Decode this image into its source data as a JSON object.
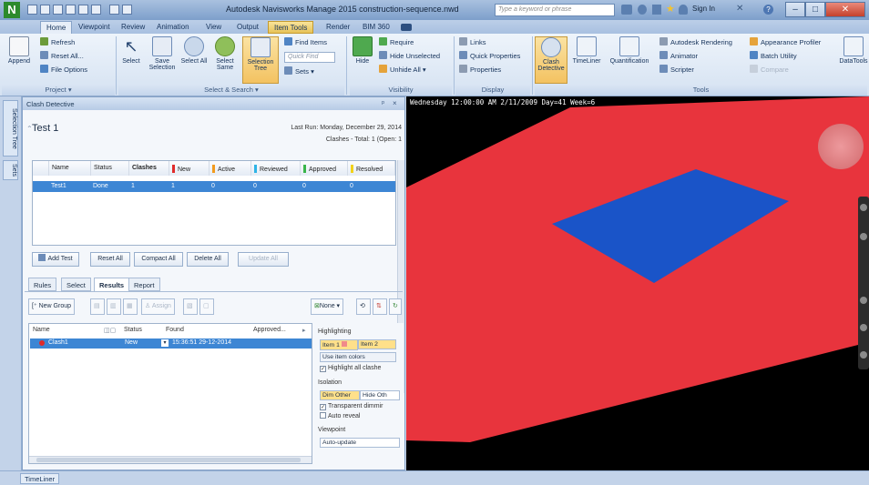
{
  "window": {
    "app_logo": "N",
    "title": "Autodesk Navisworks Manage 2015   construction-sequence.nwd",
    "search_placeholder": "Type a keyword or phrase",
    "sign_in": "Sign In",
    "colors": {
      "accent": "#3d86d4",
      "contextual_tab": "#e7c35a",
      "viewport_ground": "#e8343d",
      "viewport_plate": "#1a54c8"
    }
  },
  "tabs": [
    {
      "label": "Home"
    },
    {
      "label": "Viewpoint"
    },
    {
      "label": "Review"
    },
    {
      "label": "Animation"
    },
    {
      "label": "View"
    },
    {
      "label": "Output"
    },
    {
      "label": "Item Tools"
    },
    {
      "label": "Render"
    },
    {
      "label": "BIM 360"
    }
  ],
  "ribbon": {
    "project": {
      "append": "Append",
      "refresh": "Refresh",
      "reset_all": "Reset All...",
      "file_options": "File Options",
      "group_label": "Project ▾"
    },
    "select_search": {
      "select": "Select",
      "save_selection": "Save Selection",
      "select_all": "Select All",
      "select_same": "Select Same",
      "selection_tree": "Selection Tree",
      "find_items": "Find Items",
      "quick_find_placeholder": "Quick Find",
      "sets": "Sets",
      "group_label": "Select & Search ▾"
    },
    "visibility": {
      "hide": "Hide",
      "require": "Require",
      "hide_unselected": "Hide Unselected",
      "unhide_all": "Unhide All ▾",
      "group_label": "Visibility"
    },
    "display": {
      "links": "Links",
      "quick_properties": "Quick Properties",
      "properties": "Properties",
      "group_label": "Display"
    },
    "tools": {
      "clash_detective": "Clash Detective",
      "timeliner": "TimeLiner",
      "quantification": "Quantification",
      "autodesk_rendering": "Autodesk Rendering",
      "animator": "Animator",
      "scripter": "Scripter",
      "appearance_profiler": "Appearance Profiler",
      "batch_utility": "Batch Utility",
      "compare": "Compare",
      "datatools": "DataTools",
      "group_label": "Tools"
    }
  },
  "dock": {
    "selection_tree": "Selection Tree",
    "sets": "Sets"
  },
  "clash_panel": {
    "title": "Clash Detective",
    "pin": "×",
    "test_name": "Test 1",
    "last_run": "Last Run:  Monday, December 29, 2014",
    "summary": "Clashes - Total: 1  (Open: 1",
    "grid_headers": {
      "name": "Name",
      "status": "Status",
      "clashes": "Clashes",
      "new": "New",
      "active": "Active",
      "reviewed": "Reviewed",
      "approved": "Approved",
      "resolved": "Resolved"
    },
    "test_row": {
      "name": "Test1",
      "status": "Done",
      "clashes": "1",
      "new": "1",
      "active": "0",
      "reviewed": "0",
      "approved": "0",
      "resolved": "0"
    },
    "buttons": {
      "add_test": "Add Test",
      "reset_all": "Reset All",
      "compact_all": "Compact All",
      "delete_all": "Delete All",
      "update_all": "Update All"
    },
    "subtabs": [
      "Rules",
      "Select",
      "Results",
      "Report"
    ],
    "results_toolbar": {
      "new_group": "New Group",
      "assign": "Assign",
      "none_filter": "None ▾"
    },
    "results_headers": {
      "name": "Name",
      "status": "Status",
      "found": "Found",
      "approved": "Approved..."
    },
    "result_row": {
      "name": "Clash1",
      "status": "New",
      "found": "15:36:51 29-12-2014"
    },
    "options": {
      "highlighting": "Highlighting",
      "item1": "Item 1",
      "item2": "Item 2",
      "use_item_colors": "Use item colors",
      "highlight_all": "Highlight all clashe",
      "isolation": "Isolation",
      "dim_other": "Dim Other",
      "hide_other": "Hide Oth",
      "transparent_dimming": "Transparent dimmir",
      "auto_reveal": "Auto reveal",
      "viewpoint": "Viewpoint",
      "auto_update": "Auto-update"
    }
  },
  "viewport": {
    "overlay_text": "Wednesday 12:00:00 AM 2/11/2009 Day=41 Week=6"
  },
  "bottom": {
    "timeliner_tab": "TimeLiner"
  }
}
